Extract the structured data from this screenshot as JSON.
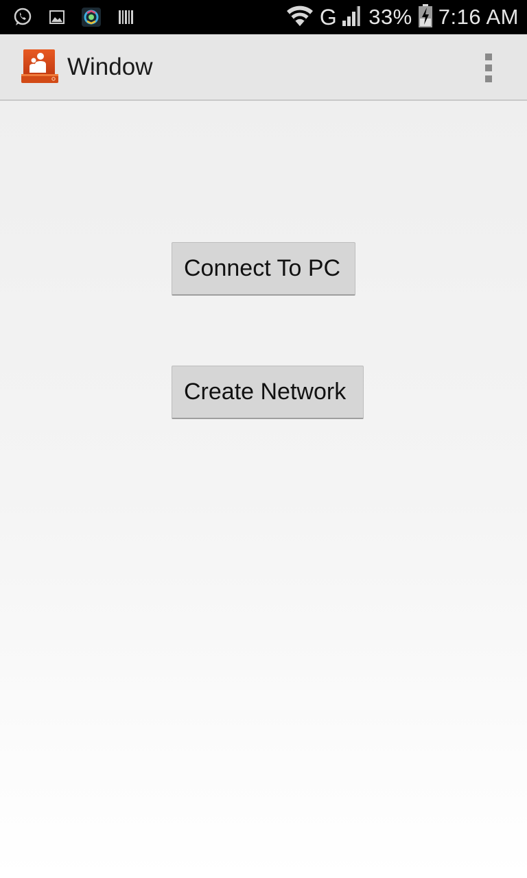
{
  "status_bar": {
    "left_icons": [
      "whatsapp-icon",
      "gallery-icon",
      "camera-app-icon",
      "barcode-icon"
    ],
    "network_type": "G",
    "battery_percent": "33%",
    "time": "7:16 AM"
  },
  "action_bar": {
    "title": "Window",
    "app_icon": "app-logo-icon",
    "overflow_icon": "overflow-menu-icon"
  },
  "main": {
    "buttons": [
      {
        "label": "Connect To PC"
      },
      {
        "label": "Create Network"
      }
    ]
  },
  "colors": {
    "status_bar_bg": "#000000",
    "action_bar_bg": "#e6e6e6",
    "button_bg": "#d6d6d6",
    "app_icon_accent": "#d2481a"
  }
}
